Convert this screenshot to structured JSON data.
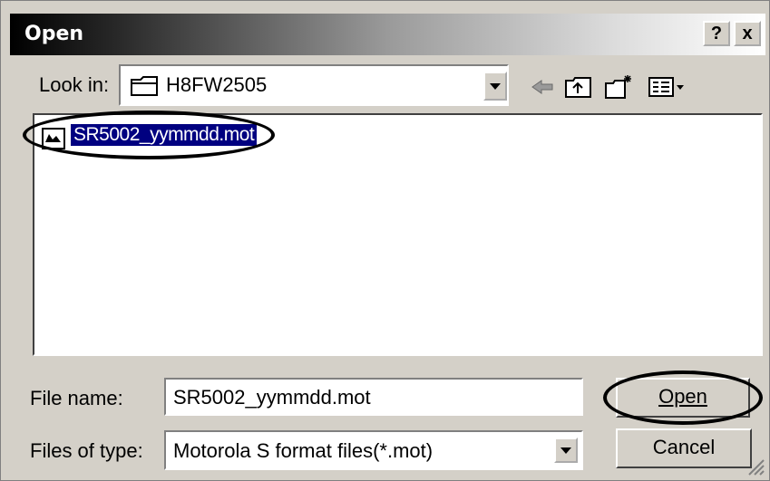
{
  "window": {
    "title": "Open",
    "help_label": "?",
    "close_label": "x"
  },
  "look_in": {
    "label": "Look in:",
    "value": "H8FW2505"
  },
  "toolbar": {
    "icons": [
      "back-arrow-icon",
      "up-folder-icon",
      "new-folder-icon",
      "view-menu-icon"
    ]
  },
  "files": [
    {
      "name": "SR5002_yymmdd.mot",
      "icon": "file-icon",
      "selected": true
    }
  ],
  "file_name": {
    "label": "File name:",
    "value": "SR5002_yymmdd.mot"
  },
  "file_type": {
    "label": "Files of type:",
    "value": "Motorola S format files(*.mot)"
  },
  "buttons": {
    "open": "Open",
    "cancel": "Cancel"
  }
}
